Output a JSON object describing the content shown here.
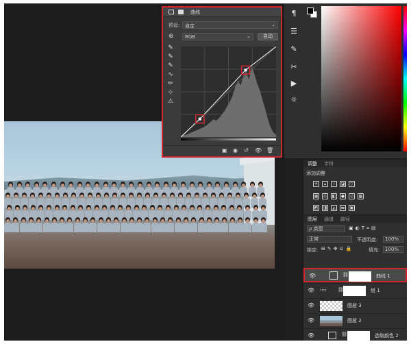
{
  "curves_panel": {
    "header_label": "曲线",
    "preset_label": "预设:",
    "preset_value": "自定",
    "channel_value": "RGB",
    "auto_button": "自动",
    "histogram": [
      2,
      3,
      4,
      6,
      8,
      10,
      12,
      14,
      16,
      18,
      22,
      26,
      30,
      28,
      32,
      38,
      44,
      52,
      60,
      70,
      86,
      96,
      88,
      104,
      112,
      98,
      120,
      108,
      92,
      80,
      64,
      48,
      30,
      16,
      8,
      4
    ],
    "curve_points": [
      [
        0,
        0
      ],
      [
        0.2,
        0.2
      ],
      [
        0.68,
        0.74
      ],
      [
        1,
        1
      ]
    ]
  },
  "tool_strip": {
    "icons": [
      "paragraph-icon",
      "adjust-sliders-icon",
      "brush-icon",
      "tools-icon",
      "play-icon",
      "lightbulb-icon"
    ]
  },
  "adjustments_panel": {
    "tabs": [
      "调整",
      "字符"
    ],
    "title": "添加调整"
  },
  "layers_panel": {
    "tabs": [
      "图层",
      "通道",
      "路径"
    ],
    "filter_label": "ρ 类型",
    "blend_mode": "正常",
    "opacity_label": "不透明度:",
    "opacity_value": "100%",
    "lock_label": "锁定:",
    "fill_label": "填充:",
    "fill_value": "100%",
    "layers": [
      {
        "name": "曲线 1",
        "selected": true
      },
      {
        "name": "组 1",
        "selected": false
      },
      {
        "name": "图层 3",
        "selected": false
      },
      {
        "name": "图层 2",
        "selected": false
      },
      {
        "name": "选取颜色 2",
        "selected": false
      }
    ]
  },
  "colors": {
    "highlight": "#d2262f",
    "panel_bg": "#3b3b3b",
    "app_bg": "#1e1e1e"
  }
}
